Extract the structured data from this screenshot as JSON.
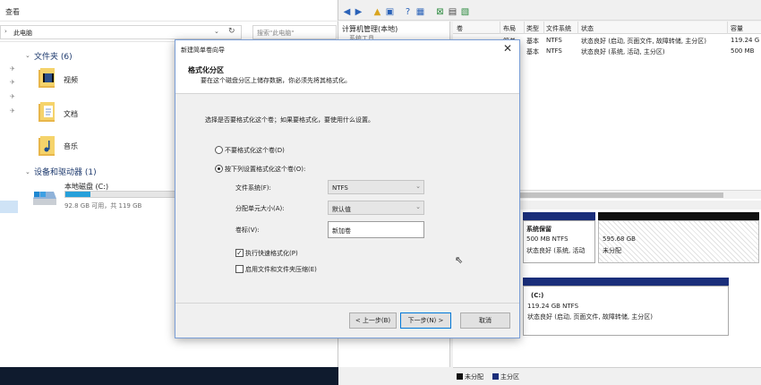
{
  "explorer": {
    "menu_label": "查看",
    "address": "此电脑",
    "search_placeholder": "搜索\"此电脑\"",
    "folders_header": "文件夹 (6)",
    "folders": [
      {
        "label": "视频",
        "icon": "video-folder-icon"
      },
      {
        "label": "文档",
        "icon": "documents-folder-icon"
      },
      {
        "label": "音乐",
        "icon": "music-folder-icon"
      }
    ],
    "devices_header": "设备和驱动器 (1)",
    "drive": {
      "name": "本地磁盘 (C:)",
      "capacity": "92.8 GB 可用，共 119 GB",
      "used_fraction": 0.22
    }
  },
  "disk_management": {
    "tree_item": "计算机管理(本地)",
    "tree_sub": "系统工具",
    "columns": [
      "卷",
      "布局",
      "类型",
      "文件系统",
      "状态",
      "容量"
    ],
    "rows": [
      {
        "layout": "简单",
        "type": "基本",
        "fs": "NTFS",
        "status": "状态良好 (启动, 页面文件, 故障转储, 主分区)",
        "capacity": "119.24 G"
      },
      {
        "layout": "简单",
        "type": "基本",
        "fs": "NTFS",
        "status": "状态良好 (系统, 活动, 主分区)",
        "capacity": "500 MB"
      }
    ],
    "disk1": {
      "partition1": {
        "name": "系统保留",
        "size": "500 MB NTFS",
        "status": "状态良好 (系统, 活动"
      },
      "unallocated": {
        "size": "595.68 GB",
        "status": "未分配"
      }
    },
    "disk2": {
      "partition": {
        "name": "(C:)",
        "size": "119.24 GB NTFS",
        "status": "状态良好 (启动, 页面文件, 故障转储, 主分区)"
      }
    },
    "legend": [
      {
        "label": "未分配",
        "color": "#111111"
      },
      {
        "label": "主分区",
        "color": "#1a2e7a"
      }
    ]
  },
  "wizard": {
    "title": "新建简单卷向导",
    "header_title": "格式化分区",
    "header_subtitle": "要在这个磁盘分区上储存数据，你必须先将其格式化。",
    "prompt": "选择是否要格式化这个卷；如果要格式化，要使用什么设置。",
    "radio_no_format": "不要格式化这个卷(D)",
    "radio_format": "按下列设置格式化这个卷(O):",
    "fs_label": "文件系统(F):",
    "fs_value": "NTFS",
    "alloc_label": "分配单元大小(A):",
    "alloc_value": "默认值",
    "vol_label": "卷标(V):",
    "vol_value": "新加卷",
    "quick_format": "执行快速格式化(P)",
    "compress": "启用文件和文件夹压缩(E)",
    "back": "< 上一步(B)",
    "next": "下一步(N) >",
    "cancel": "取消"
  }
}
